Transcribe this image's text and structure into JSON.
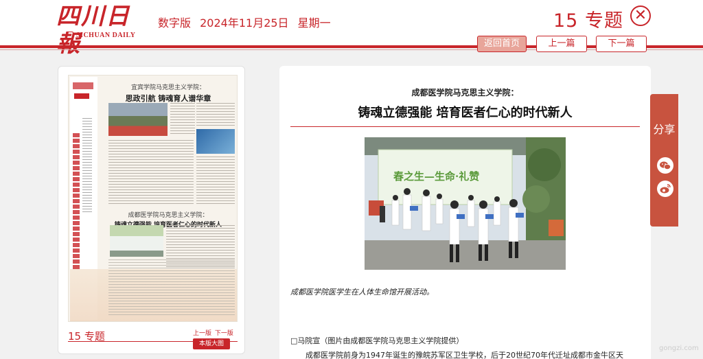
{
  "header": {
    "logo_cn": "四川日報",
    "logo_en": "SICHUAN DAILY",
    "edition_label": "数字版",
    "date": "2024年11月25日",
    "weekday": "星期一",
    "page_heading": "15 专题",
    "close_symbol": "✕"
  },
  "nav": {
    "home": "返回首页",
    "prev": "上一篇",
    "next": "下一篇"
  },
  "panel": {
    "thumb_title_small": "宜宾学院马克思主义学院：",
    "thumb_title_main": "思政引航 铸魂育人谱华章",
    "thumb_title2_small": "成都医学院马克思主义学院：",
    "thumb_title2_main": "铸魂立德强能 培育医者仁心的时代新人",
    "page_label": "15 专题",
    "prev_link": "上一版",
    "next_link": "下一版",
    "big_view": "本版大图"
  },
  "article": {
    "subtitle": "成都医学院马克思主义学院：",
    "headline": "铸魂立德强能 培育医者仁心的时代新人",
    "photo_banner": "春之生—生命·礼赞",
    "caption": "成都医学院医学生在人体生命馆开展活动。",
    "byline": "□马院宣（图片由成都医学院马克思主义学院提供）",
    "body_start": "成都医学院前身为1947年诞生的豫皖苏军区卫生学校，后于20世纪70年代迁址成都市金牛区天"
  },
  "share": {
    "label": "分享",
    "wechat_icon": "wechat-icon",
    "weibo_icon": "weibo-icon"
  },
  "watermark": "gongzi.com",
  "colors": {
    "brand_red": "#c8252a",
    "share_bg": "#c8533f",
    "page_bg": "#f1f1f1"
  }
}
